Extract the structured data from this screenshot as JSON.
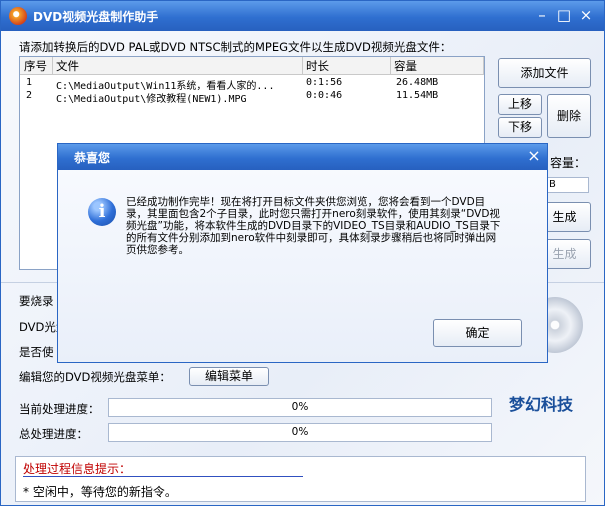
{
  "window": {
    "title": "DVD视频光盘制作助手"
  },
  "main": {
    "instruction": "请添加转换后的DVD PAL或DVD NTSC制式的MPEG文件以生成DVD视频光盘文件：",
    "columns": [
      "序号",
      "文件",
      "时长",
      "容量"
    ],
    "rows": [
      {
        "index": "1",
        "file": "C:\\MediaOutput\\Win11系统，看看人家的...",
        "duration": "0:1:56",
        "size": "26.48MB"
      },
      {
        "index": "2",
        "file": "C:\\MediaOutput\\修改教程(NEW1).MPG",
        "duration": "0:0:46",
        "size": "11.54MB"
      }
    ],
    "buttons": {
      "add_file": "添加文件",
      "move_up": "上移",
      "move_down": "下移",
      "delete": "删除",
      "generate": "生成",
      "generate2": "生成"
    },
    "capacity_label": "容量：",
    "capacity_value": "B",
    "labels": {
      "burn": "要烧录",
      "dvd_disc": "DVD光盘",
      "whether": "是否使",
      "menu_edit": "编辑您的DVD视频光盘菜单："
    },
    "edit_menu_button": "编辑菜单",
    "progress": {
      "current_label": "当前处理进度：",
      "current_value": "0%",
      "total_label": "总处理进度：",
      "total_value": "0%"
    },
    "brand": "梦幻科技",
    "info": {
      "title": "处理过程信息提示：",
      "message": "* 空闲中，等待您的新指令。"
    }
  },
  "dialog": {
    "title": "恭喜您",
    "message": "已经成功制作完毕！现在将打开目标文件夹供您浏览，您将会看到一个DVD目录，其里面包含2个子目录，此时您只需打开nero刻录软件，使用其刻录“DVD视频光盘”功能，将本软件生成的DVD目录下的VIDEO_TS目录和AUDIO_TS目录下的所有文件分别添加到nero软件中刻录即可，具体刻录步骤稍后也将同时弹出网页供您参考。",
    "ok": "确定"
  }
}
